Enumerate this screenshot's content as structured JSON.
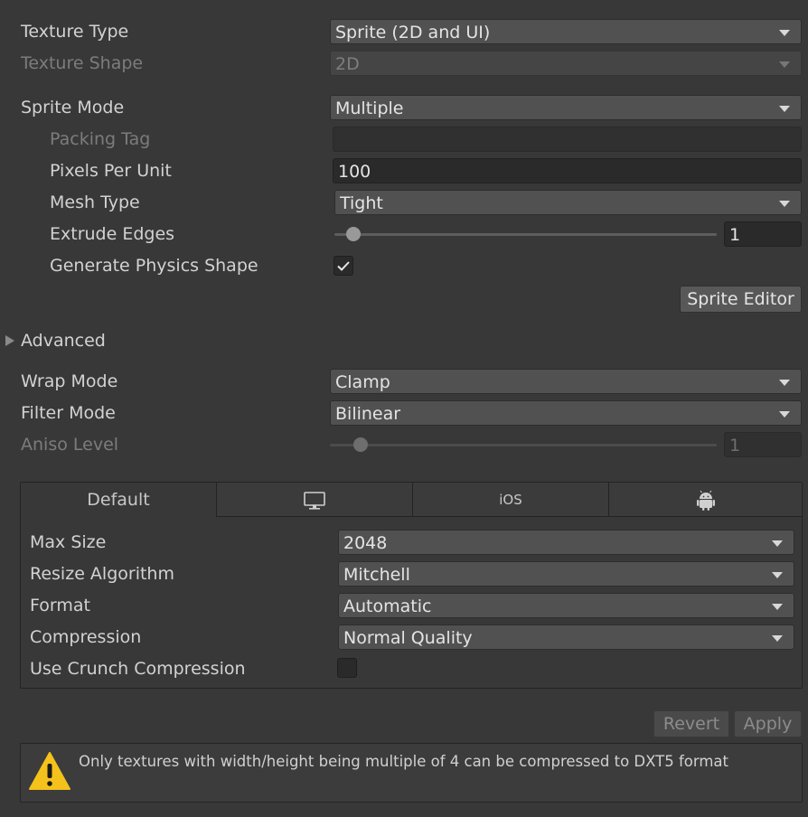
{
  "texture_type": {
    "label": "Texture Type",
    "value": "Sprite (2D and UI)"
  },
  "texture_shape": {
    "label": "Texture Shape",
    "value": "2D"
  },
  "sprite_mode": {
    "label": "Sprite Mode",
    "value": "Multiple"
  },
  "packing_tag": {
    "label": "Packing Tag",
    "value": ""
  },
  "pixels_per_unit": {
    "label": "Pixels Per Unit",
    "value": "100"
  },
  "mesh_type": {
    "label": "Mesh Type",
    "value": "Tight"
  },
  "extrude_edges": {
    "label": "Extrude Edges",
    "value": "1",
    "fraction": 0.05
  },
  "generate_physics_shape": {
    "label": "Generate Physics Shape",
    "checked": true
  },
  "sprite_editor_button": "Sprite Editor",
  "advanced": {
    "label": "Advanced",
    "expanded": false
  },
  "wrap_mode": {
    "label": "Wrap Mode",
    "value": "Clamp"
  },
  "filter_mode": {
    "label": "Filter Mode",
    "value": "Bilinear"
  },
  "aniso_level": {
    "label": "Aniso Level",
    "value": "1",
    "fraction": 0.08
  },
  "platform_tabs": [
    {
      "label": "Default",
      "icon": "",
      "active": true
    },
    {
      "label": "",
      "icon": "monitor-icon",
      "active": false
    },
    {
      "label": "iOS",
      "icon": "",
      "active": false
    },
    {
      "label": "",
      "icon": "android-icon",
      "active": false
    }
  ],
  "platform": {
    "max_size": {
      "label": "Max Size",
      "value": "2048"
    },
    "resize_algorithm": {
      "label": "Resize Algorithm",
      "value": "Mitchell"
    },
    "format": {
      "label": "Format",
      "value": "Automatic"
    },
    "compression": {
      "label": "Compression",
      "value": "Normal Quality"
    },
    "use_crunch": {
      "label": "Use Crunch Compression",
      "checked": false
    }
  },
  "buttons": {
    "revert": "Revert",
    "apply": "Apply"
  },
  "warning": {
    "text": "Only textures with width/height being multiple of 4 can be compressed to DXT5 format",
    "icon": "warning-icon",
    "color": "#f4c21b"
  }
}
